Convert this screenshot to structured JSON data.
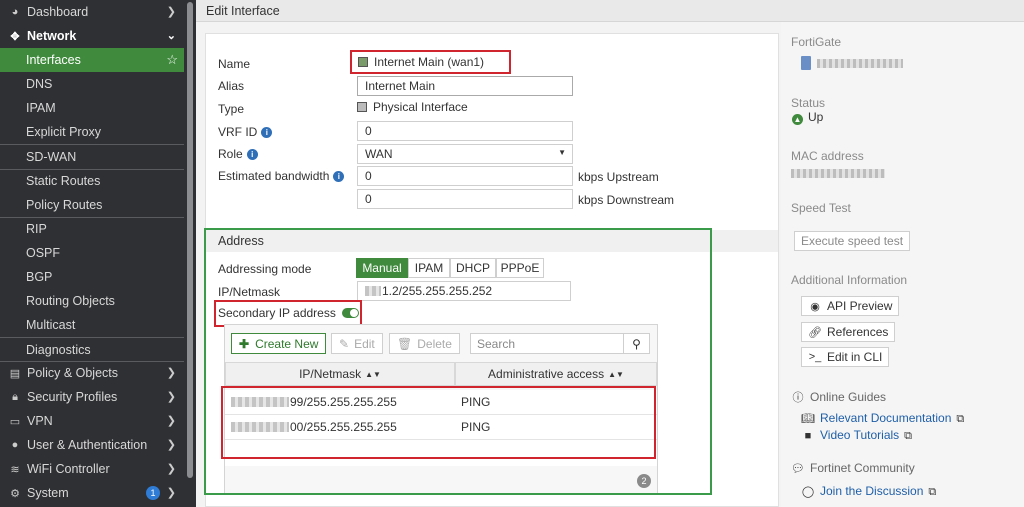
{
  "sidebar": {
    "dashboard": "Dashboard",
    "network": "Network",
    "interfaces": "Interfaces",
    "dns": "DNS",
    "ipam": "IPAM",
    "explicit_proxy": "Explicit Proxy",
    "sdwan": "SD-WAN",
    "static_routes": "Static Routes",
    "policy_routes": "Policy Routes",
    "rip": "RIP",
    "ospf": "OSPF",
    "bgp": "BGP",
    "routing_objects": "Routing Objects",
    "multicast": "Multicast",
    "diagnostics": "Diagnostics",
    "policy_objects": "Policy & Objects",
    "security_profiles": "Security Profiles",
    "vpn": "VPN",
    "user_auth": "User & Authentication",
    "wifi": "WiFi Controller",
    "system": "System",
    "system_badge": "1"
  },
  "page": {
    "title": "Edit Interface"
  },
  "form": {
    "name_label": "Name",
    "name_value": "Internet Main (wan1)",
    "alias_label": "Alias",
    "alias_value": "Internet Main",
    "type_label": "Type",
    "type_value": "Physical Interface",
    "vrf_label": "VRF ID",
    "vrf_value": "0",
    "role_label": "Role",
    "role_value": "WAN",
    "bandwidth_label": "Estimated bandwidth",
    "upstream_value": "0",
    "upstream_unit": "kbps Upstream",
    "downstream_value": "0",
    "downstream_unit": "kbps Downstream"
  },
  "address": {
    "section_title": "Address",
    "mode_label": "Addressing mode",
    "modes": [
      "Manual",
      "IPAM",
      "DHCP",
      "PPPoE"
    ],
    "ipmask_label": "IP/Netmask",
    "ipmask_value": "1.2/255.255.255.252",
    "secondary_label": "Secondary IP address",
    "create_new": "Create New",
    "edit": "Edit",
    "delete": "Delete",
    "search_placeholder": "Search",
    "col_ipmask": "IP/Netmask",
    "col_access": "Administrative access",
    "rows": [
      {
        "ip_suffix": "99/255.255.255.255",
        "access": "PING"
      },
      {
        "ip_suffix": "00/255.255.255.255",
        "access": "PING"
      }
    ],
    "row_count": "2"
  },
  "right": {
    "fortigate_label": "FortiGate",
    "status_label": "Status",
    "status_value": "Up",
    "mac_label": "MAC address",
    "speed_test_label": "Speed Test",
    "speed_test_button": "Execute speed test",
    "additional_label": "Additional Information",
    "api_preview": "API Preview",
    "references": "References",
    "edit_cli": "Edit in CLI",
    "online_guides": "Online Guides",
    "relevant_docs": "Relevant Documentation",
    "video_tutorials": "Video Tutorials",
    "community": "Fortinet Community",
    "join_discussion": "Join the Discussion"
  },
  "colors": {
    "accent": "#3f8a3c",
    "highlight_red": "#d0242f",
    "highlight_green": "#3a9b4a"
  }
}
